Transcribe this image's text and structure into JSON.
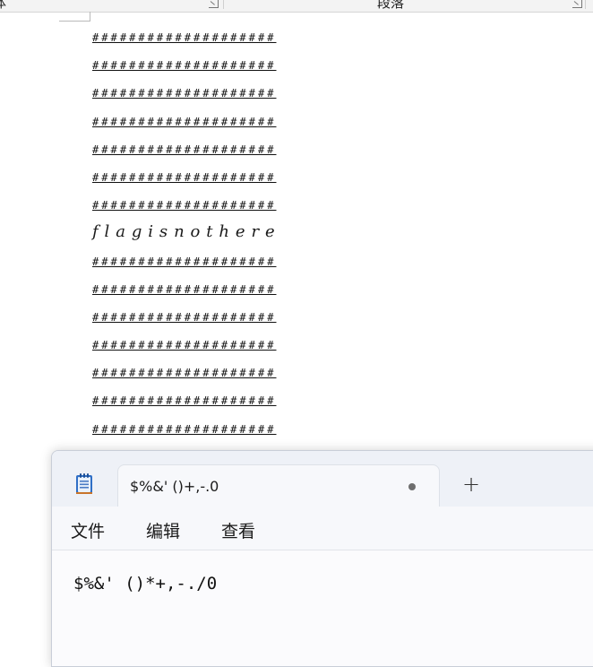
{
  "ribbon": {
    "left_group_label": "体",
    "right_group_label": "段落"
  },
  "document": {
    "lines": [
      "####################",
      "####################",
      "####################",
      "####################",
      "####################",
      "####################",
      "####################",
      "flagisnothere",
      "####################",
      "####################",
      "####################",
      "####################",
      "####################",
      "####################",
      "####################"
    ]
  },
  "notepad": {
    "tab_title": "$%&' ()+,-.0",
    "new_tab_label": "+",
    "menu": {
      "file": "文件",
      "edit": "编辑",
      "view": "查看"
    },
    "content": "$%&' ()*+,-./0"
  }
}
